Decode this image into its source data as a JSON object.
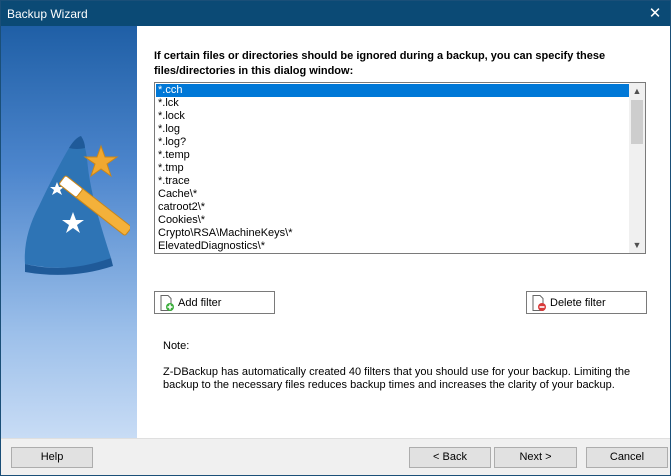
{
  "window": {
    "title": "Backup Wizard",
    "close_glyph": "✕"
  },
  "instructions": "If certain files or directories should be ignored during a backup, you can specify these files/directories in this dialog window:",
  "filters": [
    "*.cch",
    "*.lck",
    "*.lock",
    "*.log",
    "*.log?",
    "*.temp",
    "*.tmp",
    "*.trace",
    "Cache\\*",
    "catroot2\\*",
    "Cookies\\*",
    "Crypto\\RSA\\MachineKeys\\*",
    "ElevatedDiagnostics\\*"
  ],
  "selected_filter_index": 0,
  "buttons": {
    "add_filter": "Add filter",
    "delete_filter": "Delete filter",
    "help": "Help",
    "back": "< Back",
    "next": "Next >",
    "cancel": "Cancel"
  },
  "note": {
    "label": "Note:",
    "text": "Z-DBackup has automatically created  40 filters that you should use for your backup. Limiting the backup to the necessary files reduces backup times and increases the clarity of your backup."
  },
  "icons": {
    "wizard": "wizard-hat-icon",
    "add": "add-filter-icon",
    "delete": "delete-filter-icon",
    "close": "close-icon"
  },
  "colors": {
    "titlebar": "#0b4a75",
    "selection": "#0078d7",
    "side_panel_top": "#1f5fa6",
    "side_panel_bottom": "#c8dcf5",
    "hat_blue": "#2e74b5",
    "star_gold": "#f0a830"
  }
}
